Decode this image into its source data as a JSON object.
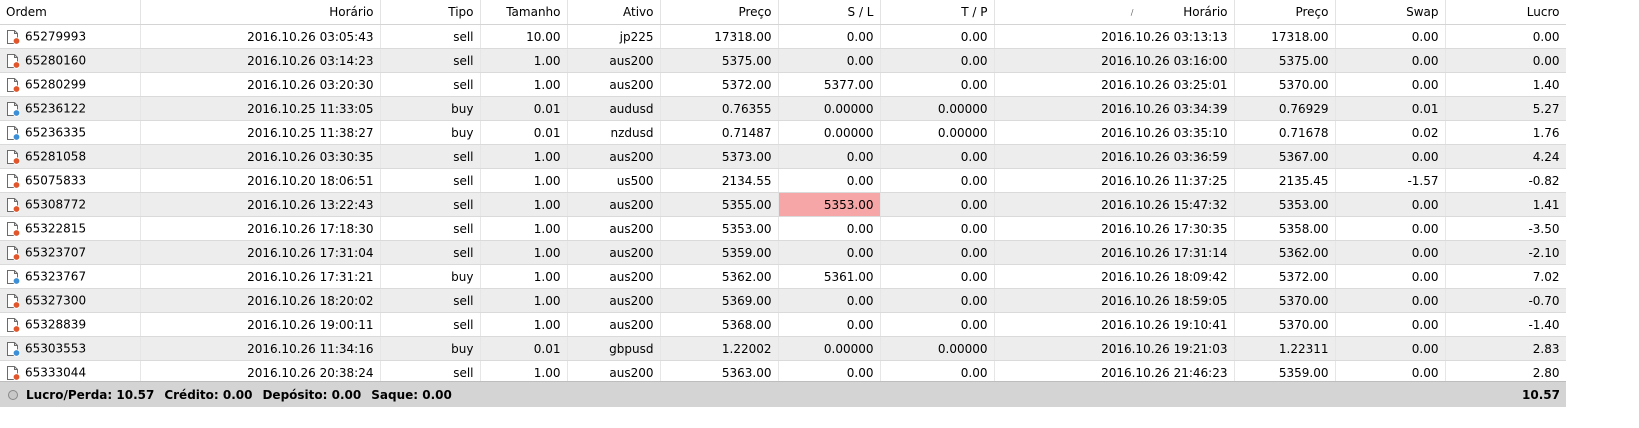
{
  "headers": [
    "Ordem",
    "Horário",
    "Tipo",
    "Tamanho",
    "Ativo",
    "Preço",
    "S / L",
    "T / P",
    "Horário",
    "Preço",
    "Swap",
    "Lucro"
  ],
  "rows": [
    {
      "ordem": "65279993",
      "open_time": "2016.10.26 03:05:43",
      "tipo": "sell",
      "tamanho": "10.00",
      "ativo": "jp225",
      "preco": "17318.00",
      "sl": "0.00",
      "tp": "0.00",
      "close_time": "2016.10.26 03:13:13",
      "close_price": "17318.00",
      "swap": "0.00",
      "lucro": "0.00"
    },
    {
      "ordem": "65280160",
      "open_time": "2016.10.26 03:14:23",
      "tipo": "sell",
      "tamanho": "1.00",
      "ativo": "aus200",
      "preco": "5375.00",
      "sl": "0.00",
      "tp": "0.00",
      "close_time": "2016.10.26 03:16:00",
      "close_price": "5375.00",
      "swap": "0.00",
      "lucro": "0.00"
    },
    {
      "ordem": "65280299",
      "open_time": "2016.10.26 03:20:30",
      "tipo": "sell",
      "tamanho": "1.00",
      "ativo": "aus200",
      "preco": "5372.00",
      "sl": "5377.00",
      "tp": "0.00",
      "close_time": "2016.10.26 03:25:01",
      "close_price": "5370.00",
      "swap": "0.00",
      "lucro": "1.40"
    },
    {
      "ordem": "65236122",
      "open_time": "2016.10.25 11:33:05",
      "tipo": "buy",
      "tamanho": "0.01",
      "ativo": "audusd",
      "preco": "0.76355",
      "sl": "0.00000",
      "tp": "0.00000",
      "close_time": "2016.10.26 03:34:39",
      "close_price": "0.76929",
      "swap": "0.01",
      "lucro": "5.27"
    },
    {
      "ordem": "65236335",
      "open_time": "2016.10.25 11:38:27",
      "tipo": "buy",
      "tamanho": "0.01",
      "ativo": "nzdusd",
      "preco": "0.71487",
      "sl": "0.00000",
      "tp": "0.00000",
      "close_time": "2016.10.26 03:35:10",
      "close_price": "0.71678",
      "swap": "0.02",
      "lucro": "1.76"
    },
    {
      "ordem": "65281058",
      "open_time": "2016.10.26 03:30:35",
      "tipo": "sell",
      "tamanho": "1.00",
      "ativo": "aus200",
      "preco": "5373.00",
      "sl": "0.00",
      "tp": "0.00",
      "close_time": "2016.10.26 03:36:59",
      "close_price": "5367.00",
      "swap": "0.00",
      "lucro": "4.24"
    },
    {
      "ordem": "65075833",
      "open_time": "2016.10.20 18:06:51",
      "tipo": "sell",
      "tamanho": "1.00",
      "ativo": "us500",
      "preco": "2134.55",
      "sl": "0.00",
      "tp": "0.00",
      "close_time": "2016.10.26 11:37:25",
      "close_price": "2135.45",
      "swap": "-1.57",
      "lucro": "-0.82"
    },
    {
      "ordem": "65308772",
      "open_time": "2016.10.26 13:22:43",
      "tipo": "sell",
      "tamanho": "1.00",
      "ativo": "aus200",
      "preco": "5355.00",
      "sl": "5353.00",
      "tp": "0.00",
      "close_time": "2016.10.26 15:47:32",
      "close_price": "5353.00",
      "swap": "0.00",
      "lucro": "1.41",
      "sl_hit": true
    },
    {
      "ordem": "65322815",
      "open_time": "2016.10.26 17:18:30",
      "tipo": "sell",
      "tamanho": "1.00",
      "ativo": "aus200",
      "preco": "5353.00",
      "sl": "0.00",
      "tp": "0.00",
      "close_time": "2016.10.26 17:30:35",
      "close_price": "5358.00",
      "swap": "0.00",
      "lucro": "-3.50"
    },
    {
      "ordem": "65323707",
      "open_time": "2016.10.26 17:31:04",
      "tipo": "sell",
      "tamanho": "1.00",
      "ativo": "aus200",
      "preco": "5359.00",
      "sl": "0.00",
      "tp": "0.00",
      "close_time": "2016.10.26 17:31:14",
      "close_price": "5362.00",
      "swap": "0.00",
      "lucro": "-2.10"
    },
    {
      "ordem": "65323767",
      "open_time": "2016.10.26 17:31:21",
      "tipo": "buy",
      "tamanho": "1.00",
      "ativo": "aus200",
      "preco": "5362.00",
      "sl": "5361.00",
      "tp": "0.00",
      "close_time": "2016.10.26 18:09:42",
      "close_price": "5372.00",
      "swap": "0.00",
      "lucro": "7.02"
    },
    {
      "ordem": "65327300",
      "open_time": "2016.10.26 18:20:02",
      "tipo": "sell",
      "tamanho": "1.00",
      "ativo": "aus200",
      "preco": "5369.00",
      "sl": "0.00",
      "tp": "0.00",
      "close_time": "2016.10.26 18:59:05",
      "close_price": "5370.00",
      "swap": "0.00",
      "lucro": "-0.70"
    },
    {
      "ordem": "65328839",
      "open_time": "2016.10.26 19:00:11",
      "tipo": "sell",
      "tamanho": "1.00",
      "ativo": "aus200",
      "preco": "5368.00",
      "sl": "0.00",
      "tp": "0.00",
      "close_time": "2016.10.26 19:10:41",
      "close_price": "5370.00",
      "swap": "0.00",
      "lucro": "-1.40"
    },
    {
      "ordem": "65303553",
      "open_time": "2016.10.26 11:34:16",
      "tipo": "buy",
      "tamanho": "0.01",
      "ativo": "gbpusd",
      "preco": "1.22002",
      "sl": "0.00000",
      "tp": "0.00000",
      "close_time": "2016.10.26 19:21:03",
      "close_price": "1.22311",
      "swap": "0.00",
      "lucro": "2.83"
    },
    {
      "ordem": "65333044",
      "open_time": "2016.10.26 20:38:24",
      "tipo": "sell",
      "tamanho": "1.00",
      "ativo": "aus200",
      "preco": "5363.00",
      "sl": "0.00",
      "tp": "0.00",
      "close_time": "2016.10.26 21:46:23",
      "close_price": "5359.00",
      "swap": "0.00",
      "lucro": "2.80"
    }
  ],
  "footer": {
    "lucro_perda": "Lucro/Perda: 10.57",
    "credito": "Crédito: 0.00",
    "deposito": "Depósito: 0.00",
    "saque": "Saque: 0.00",
    "total": "10.57"
  },
  "colors": {
    "sell_icon": "#e0552a",
    "buy_icon": "#3c8fd6",
    "sl_highlight": "#f6a6a6",
    "row_alt": "#ededed"
  }
}
